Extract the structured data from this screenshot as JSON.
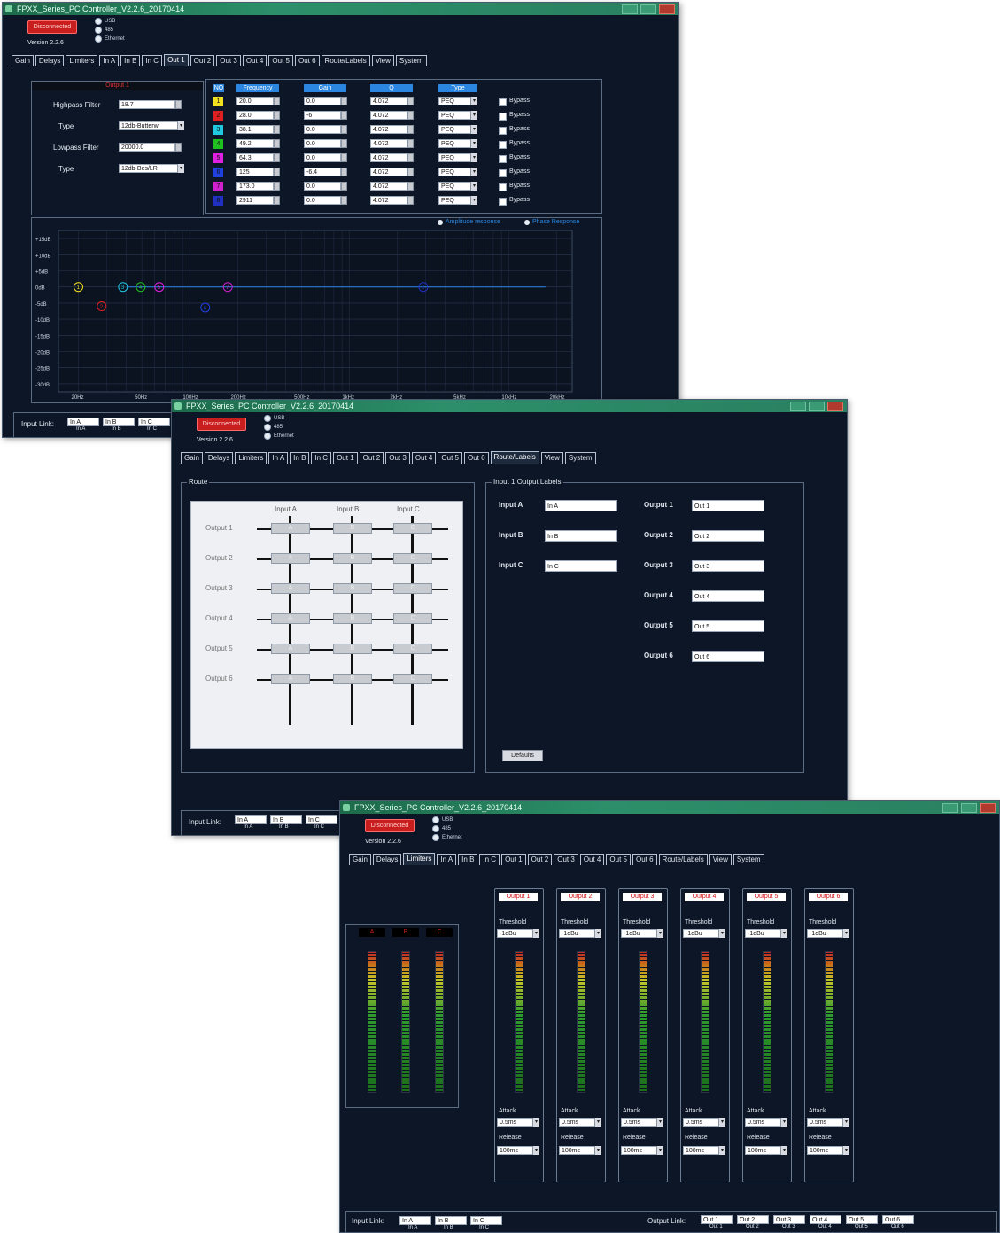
{
  "app": {
    "title": "FPXX_Series_PC Controller_V2.2.6_20170414",
    "disconnect_label": "Disconnected",
    "version": "Version 2.2.6",
    "connection_options": [
      "USB",
      "485",
      "Ethernet"
    ],
    "tabs": [
      "Gain",
      "Delays",
      "Limiters",
      "In A",
      "In B",
      "In C",
      "Out 1",
      "Out 2",
      "Out 3",
      "Out 4",
      "Out 5",
      "Out 6",
      "Route/Labels",
      "View",
      "System"
    ]
  },
  "win1": {
    "active_tab": "Out 1",
    "filter_panel": {
      "title": "Output 1",
      "highpass_label": "Highpass Filter",
      "highpass_value": "18.7",
      "type1_label": "Type",
      "type1_value": "12db-Butterw",
      "lowpass_label": "Lowpass Filter",
      "lowpass_value": "20000.0",
      "type2_label": "Type",
      "type2_value": "12db-Bes/LR"
    },
    "eq": {
      "headers": [
        "NO",
        "Frequency",
        "Gain",
        "Q",
        "Type"
      ],
      "rows": [
        {
          "no": "1",
          "color": "#f0e020",
          "freq": "20.0",
          "gain": "0.0",
          "q": "4.072",
          "type": "PEQ",
          "bypass": "Bypass"
        },
        {
          "no": "2",
          "color": "#e02020",
          "freq": "28.0",
          "gain": "-6",
          "q": "4.072",
          "type": "PEQ",
          "bypass": "Bypass"
        },
        {
          "no": "3",
          "color": "#20c8e0",
          "freq": "38.1",
          "gain": "0.0",
          "q": "4.072",
          "type": "PEQ",
          "bypass": "Bypass"
        },
        {
          "no": "4",
          "color": "#20c020",
          "freq": "49.2",
          "gain": "0.0",
          "q": "4.072",
          "type": "PEQ",
          "bypass": "Bypass"
        },
        {
          "no": "5",
          "color": "#e020e0",
          "freq": "64.3",
          "gain": "0.0",
          "q": "4.072",
          "type": "PEQ",
          "bypass": "Bypass"
        },
        {
          "no": "6",
          "color": "#2040e0",
          "freq": "125",
          "gain": "-6.4",
          "q": "4.072",
          "type": "PEQ",
          "bypass": "Bypass"
        },
        {
          "no": "7",
          "color": "#d020d0",
          "freq": "173.0",
          "gain": "0.0",
          "q": "4.072",
          "type": "PEQ",
          "bypass": "Bypass"
        },
        {
          "no": "8",
          "color": "#2030c0",
          "freq": "2911",
          "gain": "0.0",
          "q": "4.072",
          "type": "PEQ",
          "bypass": "Bypass"
        }
      ]
    },
    "graph": {
      "amp_label": "Amplitude response",
      "phase_label": "Phase Response",
      "y_ticks": [
        "+15dB",
        "+10dB",
        "+5dB",
        "0dB",
        "-5dB",
        "-10dB",
        "-15dB",
        "-20dB",
        "-25dB",
        "-30dB"
      ],
      "x_ticks": [
        "20Hz",
        "50Hz",
        "100Hz",
        "200Hz",
        "500Hz",
        "1kHz",
        "2kHz",
        "5kHz",
        "10kHz",
        "20kHz"
      ]
    },
    "input_link_label": "Input Link:",
    "input_links": [
      "In A",
      "In B",
      "In C"
    ]
  },
  "win2": {
    "active_tab": "Route/Labels",
    "route_title": "Route",
    "inputs": [
      "Input A",
      "Input B",
      "Input C"
    ],
    "outputs": [
      "Output 1",
      "Output 2",
      "Output 3",
      "Output 4",
      "Output 5",
      "Output 6"
    ],
    "matrix": [
      [
        "A",
        "B",
        "C"
      ],
      [
        "A",
        "B",
        "C"
      ],
      [
        "A",
        "B",
        "C"
      ],
      [
        "A",
        "B",
        "C"
      ],
      [
        "A",
        "B",
        "C"
      ],
      [
        "A",
        "B",
        "C"
      ]
    ],
    "labels_title": "Input 1 Output Labels",
    "input_labels": [
      {
        "label": "Input A",
        "value": "In A"
      },
      {
        "label": "Input B",
        "value": "In B"
      },
      {
        "label": "Input C",
        "value": "In C"
      }
    ],
    "output_labels": [
      {
        "label": "Output 1",
        "value": "Out 1"
      },
      {
        "label": "Output 2",
        "value": "Out 2"
      },
      {
        "label": "Output 3",
        "value": "Out 3"
      },
      {
        "label": "Output 4",
        "value": "Out 4"
      },
      {
        "label": "Output 5",
        "value": "Out 5"
      },
      {
        "label": "Output 6",
        "value": "Out 6"
      }
    ],
    "defaults_label": "Defaults",
    "input_link_label": "Input Link:",
    "input_links": [
      "In A",
      "In B",
      "In C"
    ]
  },
  "win3": {
    "active_tab": "Limiters",
    "input_meters": [
      "A",
      "B",
      "C"
    ],
    "outputs": [
      {
        "name": "Output 1",
        "threshold_label": "Threshold",
        "threshold": "-1dBu",
        "attack_label": "Attack",
        "attack": "0.5ms",
        "release_label": "Release",
        "release": "100ms"
      },
      {
        "name": "Output 2",
        "threshold_label": "Threshold",
        "threshold": "-1dBu",
        "attack_label": "Attack",
        "attack": "0.5ms",
        "release_label": "Release",
        "release": "100ms"
      },
      {
        "name": "Output 3",
        "threshold_label": "Threshold",
        "threshold": "-1dBu",
        "attack_label": "Attack",
        "attack": "0.5ms",
        "release_label": "Release",
        "release": "100ms"
      },
      {
        "name": "Output 4",
        "threshold_label": "Threshold",
        "threshold": "-1dBu",
        "attack_label": "Attack",
        "attack": "0.5ms",
        "release_label": "Release",
        "release": "100ms"
      },
      {
        "name": "Output 5",
        "threshold_label": "Threshold",
        "threshold": "-1dBu",
        "attack_label": "Attack",
        "attack": "0.5ms",
        "release_label": "Release",
        "release": "100ms"
      },
      {
        "name": "Output 6",
        "threshold_label": "Threshold",
        "threshold": "-1dBu",
        "attack_label": "Attack",
        "attack": "0.5ms",
        "release_label": "Release",
        "release": "100ms"
      }
    ],
    "input_link_label": "Input Link:",
    "input_links": [
      "In A",
      "In B",
      "In C"
    ],
    "output_link_label": "Output Link:",
    "output_links": [
      "Out 1",
      "Out 2",
      "Out 3",
      "Out 4",
      "Out 5",
      "Out 6"
    ]
  }
}
